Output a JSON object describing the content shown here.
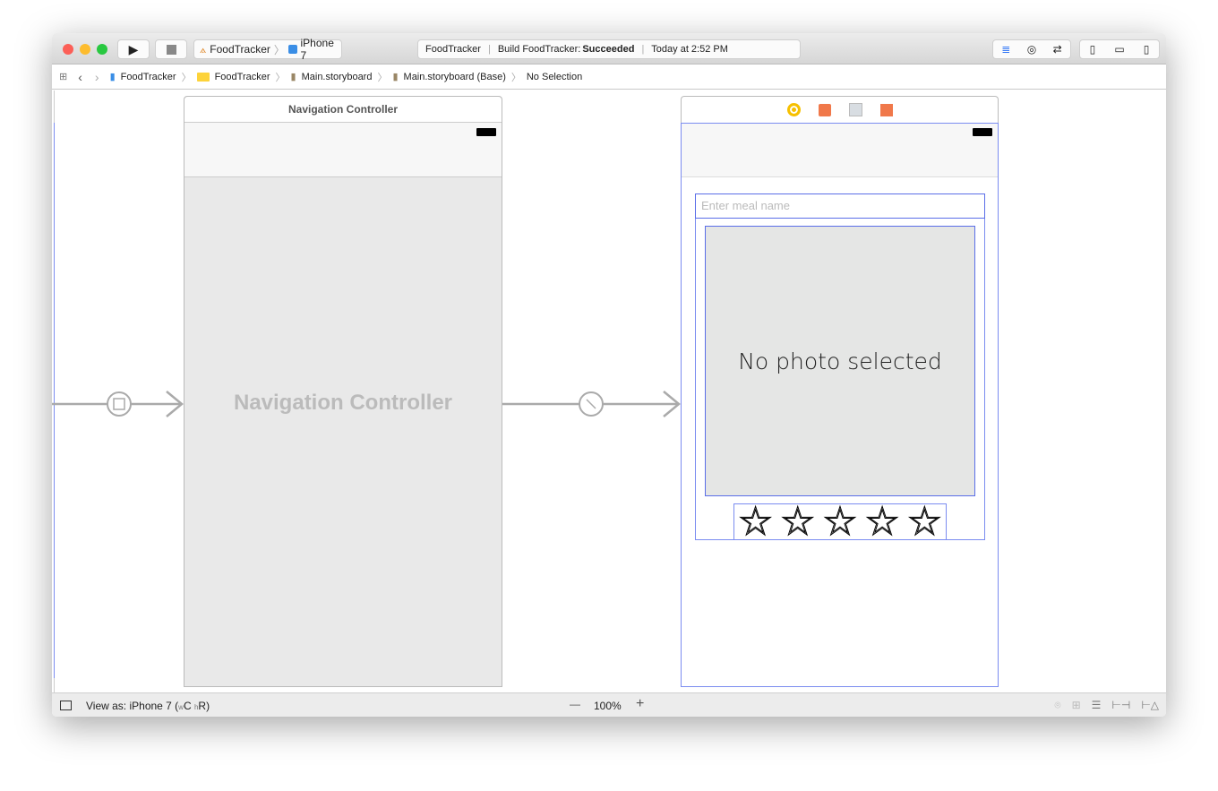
{
  "window": {
    "scheme": "FoodTracker",
    "device": "iPhone 7",
    "activity": {
      "project": "FoodTracker",
      "build_label": "Build FoodTracker:",
      "build_status": "Succeeded",
      "time": "Today at 2:52 PM"
    }
  },
  "breadcrumb": [
    "FoodTracker",
    "FoodTracker",
    "Main.storyboard",
    "Main.storyboard (Base)",
    "No Selection"
  ],
  "canvas": {
    "nav_controller": {
      "title": "Navigation Controller",
      "placeholder": "Navigation Controller"
    },
    "meal_scene": {
      "text_field_placeholder": "Enter meal name",
      "image_label": "No photo selected",
      "rating": 0,
      "stars": 5
    }
  },
  "bottom_bar": {
    "view_as": "View as: iPhone 7 (",
    "w": "w",
    "c": "C",
    "h": "h",
    "r": "R",
    ")": ")",
    "zoom_minus": "—",
    "zoom": "100%",
    "zoom_plus": "+"
  },
  "colors": {
    "selection": "#7b8cf0",
    "accent": "#3478f6"
  }
}
